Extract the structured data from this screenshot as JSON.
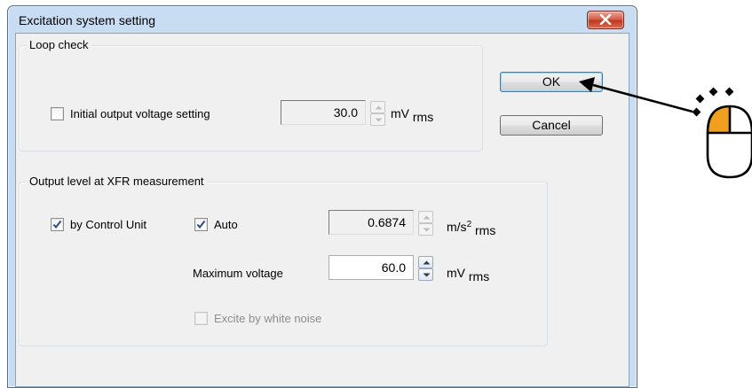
{
  "window": {
    "title": "Excitation system setting"
  },
  "loop_check": {
    "group_label": "Loop check",
    "initial_output_checkbox": {
      "label": "Initial output voltage setting",
      "checked": false
    },
    "voltage_value": "30.0",
    "unit_main": "mV",
    "unit_sub": "rms"
  },
  "buttons": {
    "ok": "OK",
    "cancel": "Cancel"
  },
  "output_level": {
    "group_label": "Output level at XFR measurement",
    "by_control_unit": {
      "label": "by Control Unit",
      "checked": true
    },
    "auto": {
      "label": "Auto",
      "checked": true
    },
    "accel_value": "0.6874",
    "accel_unit_main": "m/s",
    "accel_unit_sup": "2",
    "accel_unit_sub": "rms",
    "max_voltage_label": "Maximum voltage",
    "max_voltage_value": "60.0",
    "max_unit_main": "mV",
    "max_unit_sub": "rms",
    "white_noise": {
      "label": "Excite by white noise",
      "checked": false,
      "enabled": false
    }
  },
  "annotation": {
    "icon": "mouse-click-icon",
    "accent": "#f0a01e"
  }
}
